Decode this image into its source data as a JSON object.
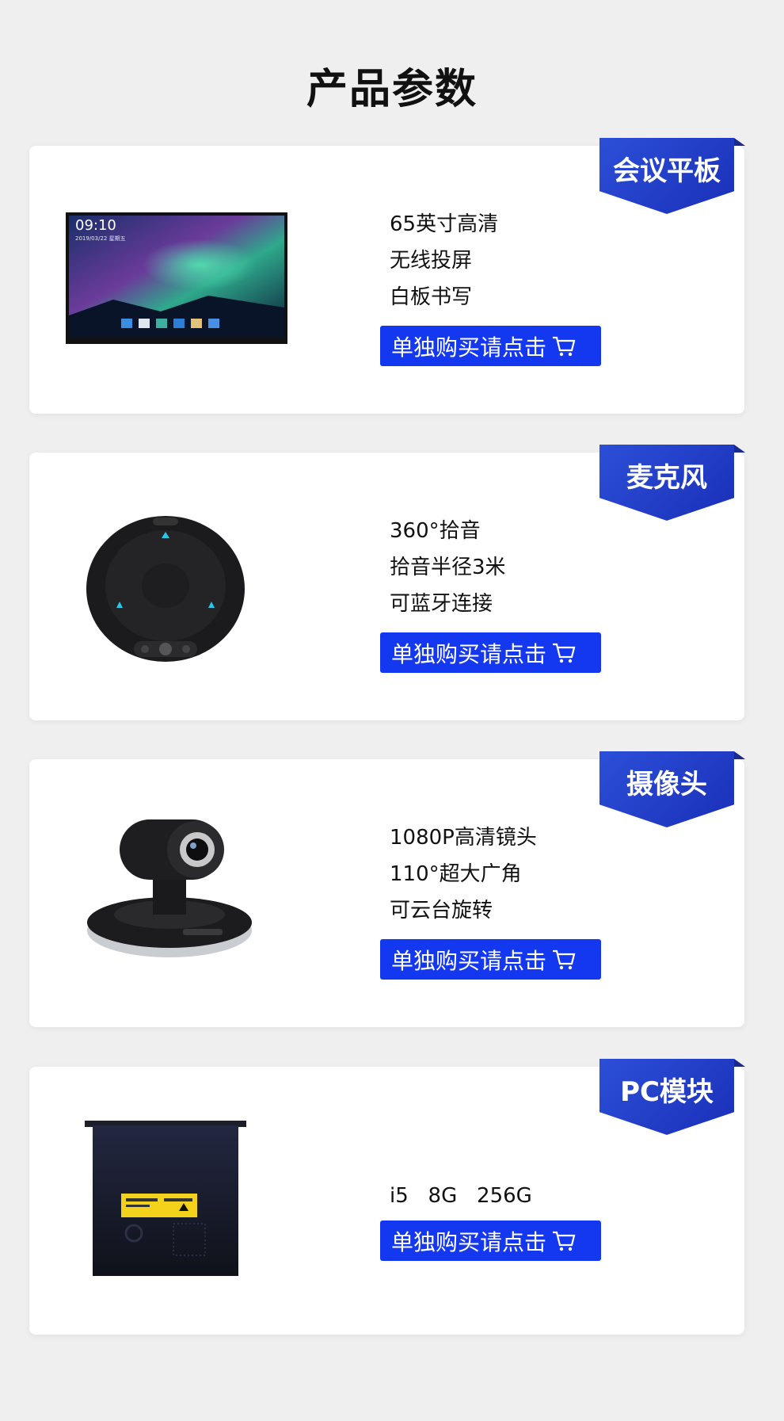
{
  "page": {
    "title": "产品参数"
  },
  "buy_label": "单独购买请点击",
  "products": [
    {
      "ribbon": "会议平板",
      "features": [
        "65英寸高清",
        "无线投屏",
        "白板书写"
      ],
      "screen_time": "09:10",
      "screen_date": "2019/03/22  星期五"
    },
    {
      "ribbon": "麦克风",
      "features": [
        "360°拾音",
        "拾音半径3米",
        "可蓝牙连接"
      ]
    },
    {
      "ribbon": "摄像头",
      "features": [
        "1080P高清镜头",
        "110°超大广角",
        "可云台旋转"
      ]
    },
    {
      "ribbon": "PC模块",
      "features": [
        "i5   8G   256G"
      ]
    }
  ],
  "colors": {
    "accent": "#1438f0",
    "ribbon": "#2c4fd8",
    "background": "#efeff0"
  }
}
